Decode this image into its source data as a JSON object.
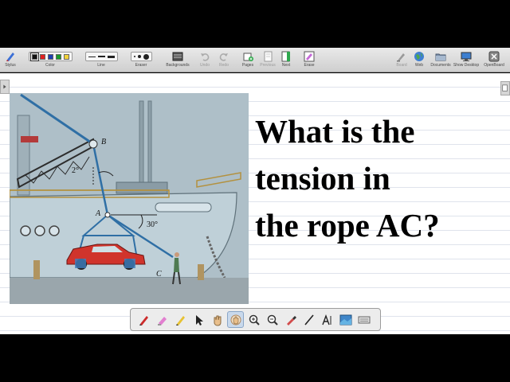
{
  "toolbar": {
    "stylus_label": "Stylus",
    "color_label": "Color",
    "line_label": "Line",
    "eraser_size_label": "Eraser",
    "backgrounds_label": "Backgrounds",
    "undo_label": "Undo",
    "redo_label": "Redo",
    "pages_label": "Pages",
    "previous_label": "Previous",
    "next_label": "Next",
    "erase_label": "Erase",
    "board_label": "Board",
    "web_label": "Web",
    "documents_label": "Documents",
    "show_desktop_label": "Show Desktop",
    "openboard_label": "OpenBoard",
    "colors": [
      "#111111",
      "#e02020",
      "#1e3fb0",
      "#1a9a2a",
      "#f2d23a"
    ]
  },
  "question": {
    "line1": "What is the",
    "line2": "tension in",
    "line3": "the rope AC?"
  },
  "figure": {
    "label_b": "B",
    "label_a": "A",
    "label_c": "C",
    "angle_top": "2°",
    "angle_bottom": "30°"
  },
  "palette": {
    "tools": [
      "pen-icon",
      "marker-icon",
      "highlighter-icon",
      "pointer-icon",
      "hand-icon",
      "laser-icon",
      "zoom-in-icon",
      "zoom-out-icon",
      "pipette-icon",
      "line-icon",
      "text-icon",
      "capture-icon",
      "keyboard-icon"
    ]
  }
}
